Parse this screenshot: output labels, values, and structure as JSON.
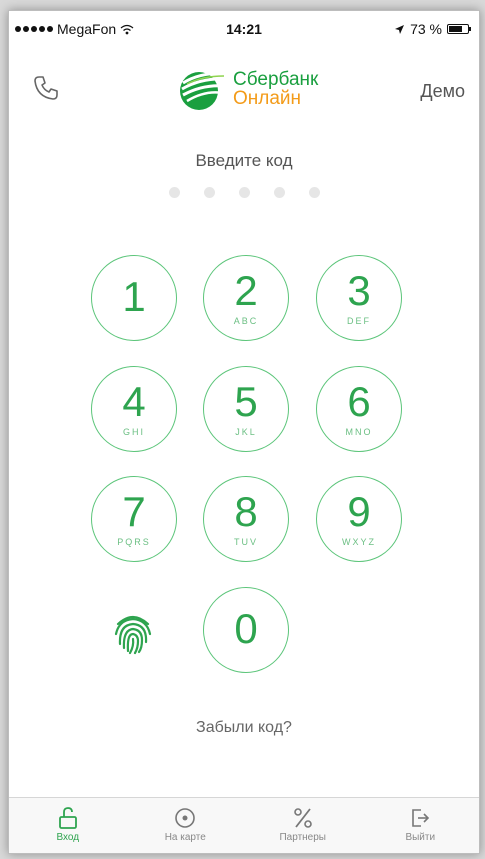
{
  "status_bar": {
    "carrier": "MegaFon",
    "time": "14:21",
    "battery": "73 %",
    "battery_level": 0.73
  },
  "header": {
    "logo_line1": "Сбербанк",
    "logo_line2": "Онлайн",
    "demo_label": "Демо"
  },
  "prompt": "Введите код",
  "pin": {
    "length": 5,
    "entered": 0
  },
  "keypad": [
    {
      "digit": "1",
      "letters": ""
    },
    {
      "digit": "2",
      "letters": "ABC"
    },
    {
      "digit": "3",
      "letters": "DEF"
    },
    {
      "digit": "4",
      "letters": "GHI"
    },
    {
      "digit": "5",
      "letters": "JKL"
    },
    {
      "digit": "6",
      "letters": "MNO"
    },
    {
      "digit": "7",
      "letters": "PQRS"
    },
    {
      "digit": "8",
      "letters": "TUV"
    },
    {
      "digit": "9",
      "letters": "WXYZ"
    },
    {
      "digit": "0",
      "letters": ""
    }
  ],
  "forgot_label": "Забыли код?",
  "tabs": [
    {
      "label": "Вход",
      "icon": "unlock-icon",
      "active": true
    },
    {
      "label": "На карте",
      "icon": "map-pin-icon",
      "active": false
    },
    {
      "label": "Партнеры",
      "icon": "percent-icon",
      "active": false
    },
    {
      "label": "Выйти",
      "icon": "logout-icon",
      "active": false
    }
  ],
  "colors": {
    "accent_green": "#2ea44f",
    "brand_orange": "#f39b19"
  }
}
